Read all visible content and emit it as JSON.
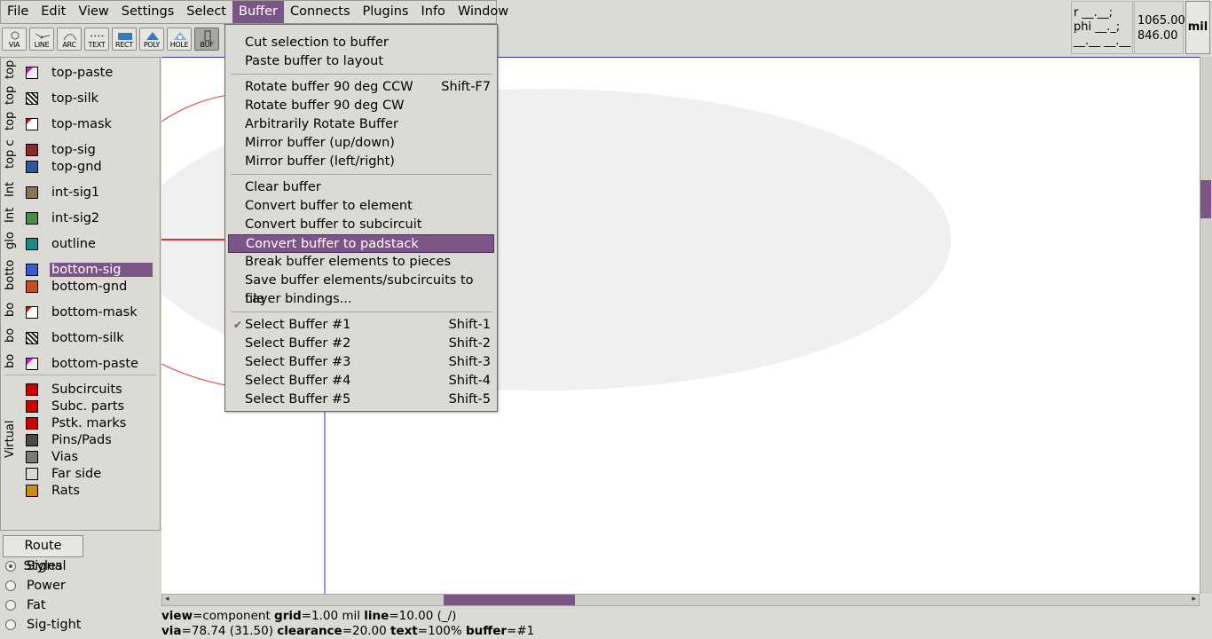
{
  "menubar": [
    "File",
    "Edit",
    "View",
    "Settings",
    "Select",
    "Buffer",
    "Connects",
    "Plugins",
    "Info",
    "Window"
  ],
  "active_menu": "Buffer",
  "toolbar": [
    "VIA",
    "LINE",
    "ARC",
    "TEXT",
    "RECT",
    "POLY",
    "HOLE",
    "BUF"
  ],
  "coords": {
    "r_label": "r __.__;",
    "phi_label": "phi __._;",
    "blank": "__.__ __.__",
    "x": "1065.00",
    "y": "846.00",
    "unit": "mil"
  },
  "layer_groups": [
    {
      "label": "top"
    },
    {
      "label": "top"
    },
    {
      "label": "top"
    },
    {
      "label": "top c"
    },
    {
      "label": "Int"
    },
    {
      "label": "Int"
    },
    {
      "label": "glo"
    },
    {
      "label": "botto"
    },
    {
      "label": "bo"
    },
    {
      "label": "bo"
    },
    {
      "label": "bo"
    },
    {
      "label": "Virtual"
    }
  ],
  "layers": [
    {
      "name": "top-paste",
      "color": "#e8e0e8"
    },
    {
      "name": "top-silk",
      "color": "#222222"
    },
    {
      "name": "top-mask",
      "color": "#ffffff"
    },
    {
      "name": "top-sig",
      "color": "#8b2a2a"
    },
    {
      "name": "top-gnd",
      "color": "#2a5a9a"
    },
    {
      "name": "int-sig1",
      "color": "#8b7355"
    },
    {
      "name": "int-sig2",
      "color": "#4a8a4a"
    },
    {
      "name": "outline",
      "color": "#1a8a8a"
    },
    {
      "name": "bottom-sig",
      "color": "#3a5ad0"
    },
    {
      "name": "bottom-gnd",
      "color": "#d04a1a"
    },
    {
      "name": "bottom-mask",
      "color": "#ffffff"
    },
    {
      "name": "bottom-silk",
      "color": "#222222"
    },
    {
      "name": "bottom-paste",
      "color": "#e8e0e8"
    }
  ],
  "selected_layer": "bottom-sig",
  "virtual_layers": [
    {
      "name": "Subcircuits",
      "color": "#d00000"
    },
    {
      "name": "Subc. parts",
      "color": "#d00000"
    },
    {
      "name": "Pstk. marks",
      "color": "#d00000"
    },
    {
      "name": "Pins/Pads",
      "color": "#4a4a4a"
    },
    {
      "name": "Vias",
      "color": "#7a7a7a"
    },
    {
      "name": "Far side",
      "color": "#dcdad5"
    },
    {
      "name": "Rats",
      "color": "#c8900a"
    }
  ],
  "route_styles": {
    "button": "Route Styles",
    "items": [
      "Signal",
      "Power",
      "Fat",
      "Sig-tight"
    ],
    "selected": "Signal"
  },
  "status": {
    "line1": [
      [
        "view",
        "component"
      ],
      [
        "grid",
        "1.00 mil"
      ],
      [
        "line",
        "10.00 (_/)"
      ]
    ],
    "line2": [
      [
        "via",
        "78.74 (31.50)"
      ],
      [
        "clearance",
        "20.00"
      ],
      [
        "text",
        "100%"
      ],
      [
        "buffer",
        "#1"
      ]
    ]
  },
  "buffer_menu": {
    "groups": [
      [
        {
          "label": "Cut selection to buffer",
          "shortcut": ""
        },
        {
          "label": "Paste buffer to layout",
          "shortcut": ""
        }
      ],
      [
        {
          "label": "Rotate buffer 90 deg CCW",
          "shortcut": "Shift-F7"
        },
        {
          "label": "Rotate buffer 90 deg CW",
          "shortcut": ""
        },
        {
          "label": "Arbitrarily Rotate Buffer",
          "shortcut": ""
        },
        {
          "label": "Mirror buffer (up/down)",
          "shortcut": ""
        },
        {
          "label": "Mirror buffer (left/right)",
          "shortcut": ""
        }
      ],
      [
        {
          "label": "Clear buffer",
          "shortcut": ""
        },
        {
          "label": "Convert buffer to element",
          "shortcut": ""
        },
        {
          "label": "Convert buffer to subcircuit",
          "shortcut": ""
        },
        {
          "label": "Convert buffer to padstack",
          "shortcut": ""
        },
        {
          "label": "Break buffer elements to pieces",
          "shortcut": ""
        },
        {
          "label": "Save buffer elements/subcircuits to file",
          "shortcut": ""
        },
        {
          "label": "Layer bindings...",
          "shortcut": ""
        }
      ],
      [
        {
          "label": "Select Buffer #1",
          "shortcut": "Shift-1"
        },
        {
          "label": "Select Buffer #2",
          "shortcut": "Shift-2"
        },
        {
          "label": "Select Buffer #3",
          "shortcut": "Shift-3"
        },
        {
          "label": "Select Buffer #4",
          "shortcut": "Shift-4"
        },
        {
          "label": "Select Buffer #5",
          "shortcut": "Shift-5"
        }
      ]
    ],
    "highlighted": "Convert buffer to padstack",
    "checked": "Select Buffer #1"
  },
  "colors": {
    "accent": "#7c5588"
  }
}
